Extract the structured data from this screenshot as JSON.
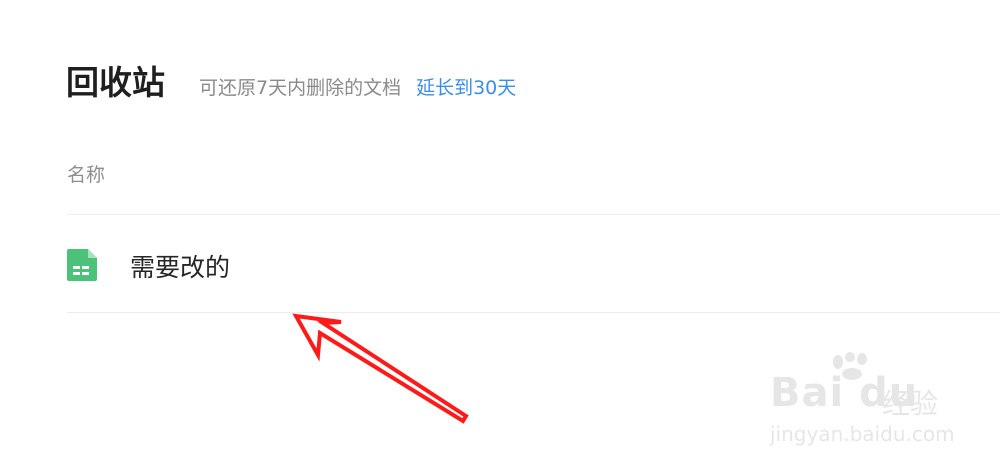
{
  "header": {
    "title": "回收站",
    "subtitle": "可还原7天内删除的文档",
    "extend_link": "延长到30天"
  },
  "table": {
    "column_name": "名称",
    "rows": [
      {
        "name": "需要改的",
        "icon": "spreadsheet-icon"
      }
    ]
  },
  "annotation": {
    "arrow_color": "#ff1a1a"
  },
  "watermark": {
    "brand": "Bai du",
    "brand_suffix": "经验",
    "url": "jingyan.baidu.com"
  },
  "colors": {
    "link": "#3b8ee8",
    "spreadsheet_icon": "#4cc17a"
  }
}
